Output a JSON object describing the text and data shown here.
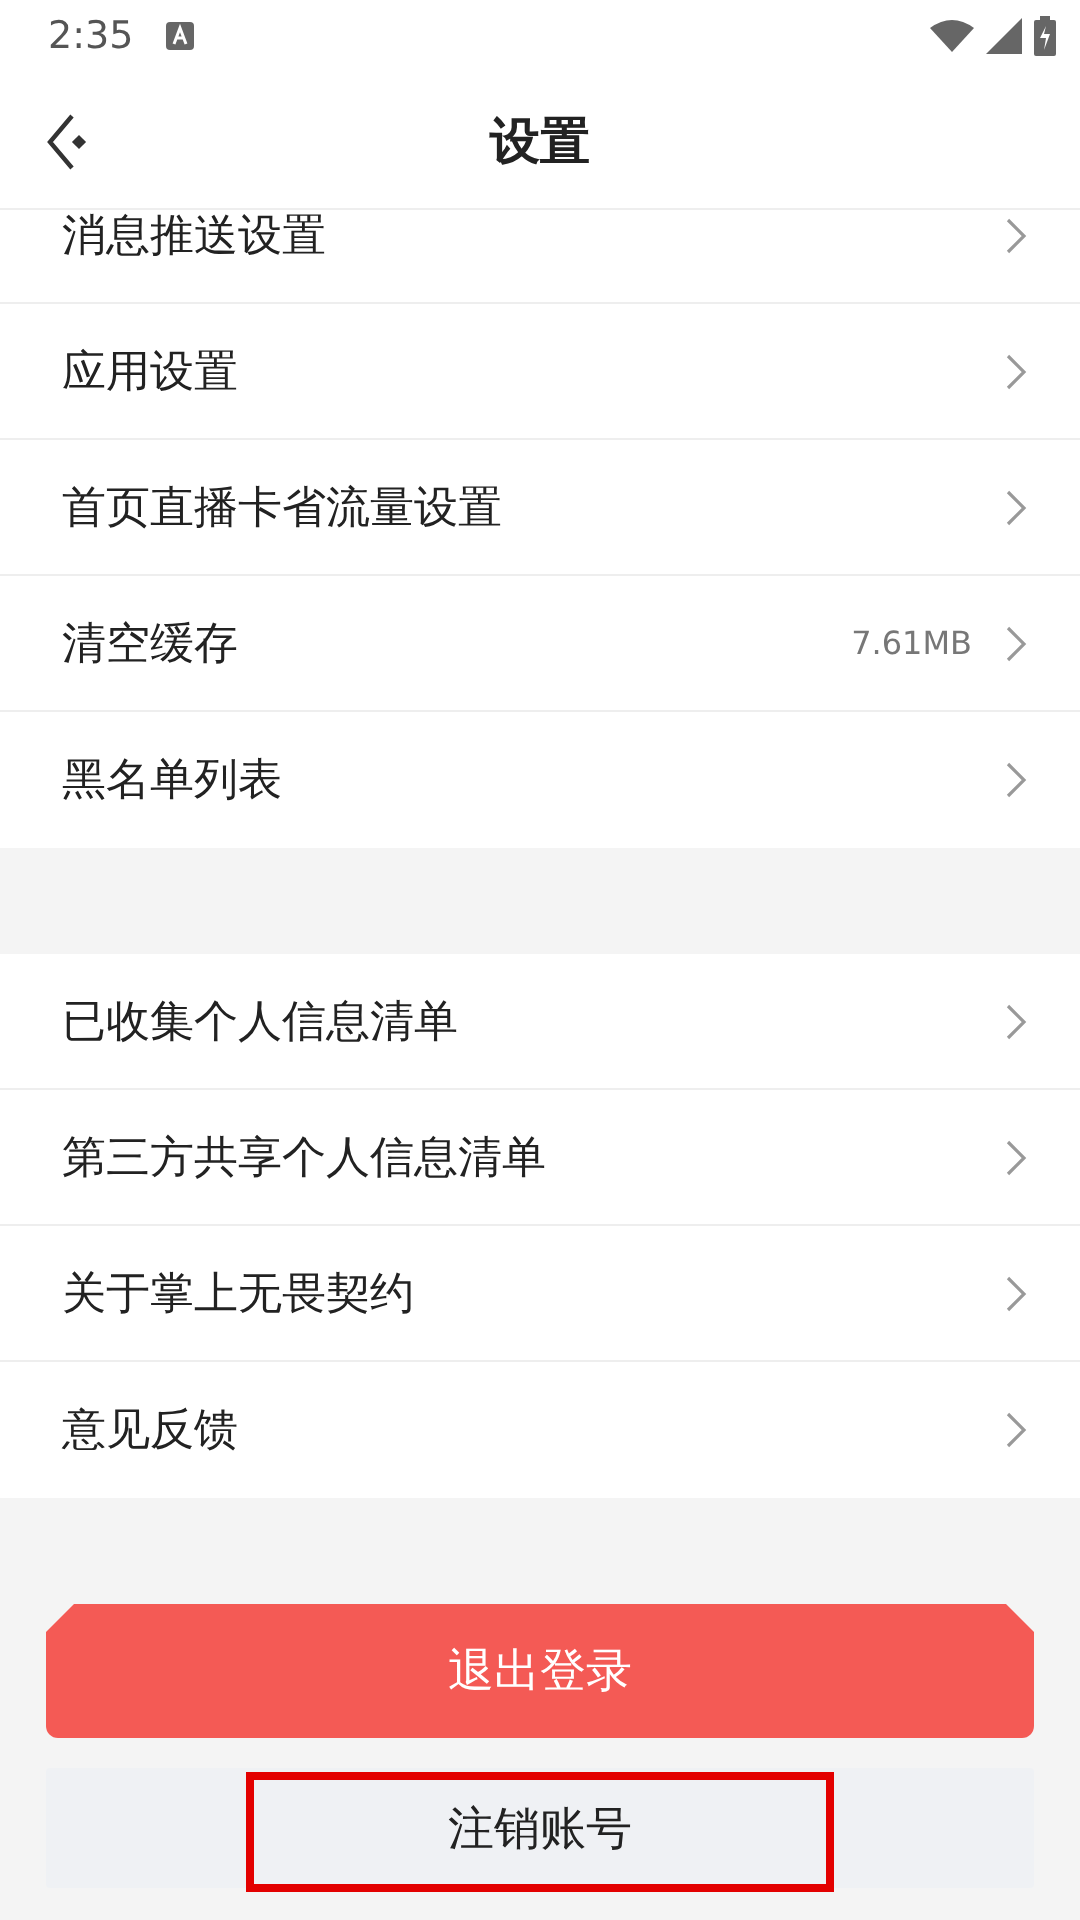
{
  "status_bar": {
    "time": "2:35"
  },
  "header": {
    "title": "设置"
  },
  "sections": [
    {
      "items": [
        {
          "label": "消息推送设置"
        },
        {
          "label": "应用设置"
        },
        {
          "label": "首页直播卡省流量设置"
        },
        {
          "label": "清空缓存",
          "value": "7.61MB"
        },
        {
          "label": "黑名单列表"
        }
      ]
    },
    {
      "items": [
        {
          "label": "已收集个人信息清单"
        },
        {
          "label": "第三方共享个人信息清单"
        },
        {
          "label": "关于掌上无畏契约"
        },
        {
          "label": "意见反馈"
        }
      ]
    }
  ],
  "buttons": [
    {
      "kind": "primary",
      "label": "退出登录",
      "highlighted": false
    },
    {
      "kind": "secondary",
      "label": "注销账号",
      "highlighted": true
    }
  ]
}
